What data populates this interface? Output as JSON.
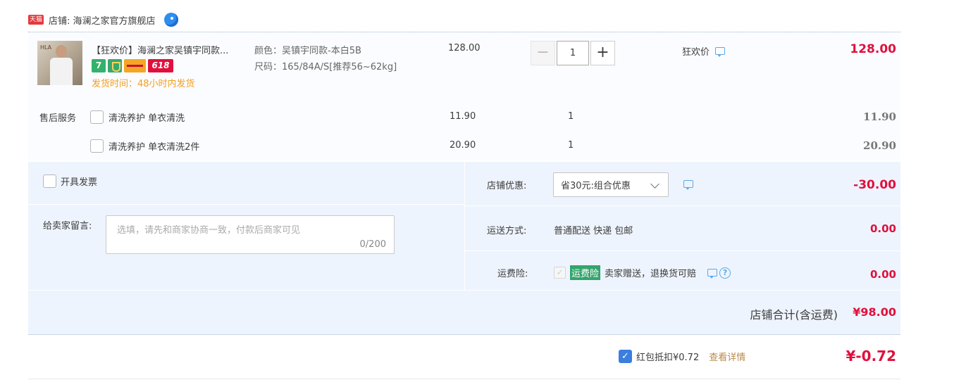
{
  "shop": {
    "badge": "天猫",
    "name": "店铺: 海澜之家官方旗舰店"
  },
  "item": {
    "thumb_caption": "HLA",
    "title": "【狂欢价】海澜之家吴镇宇同款...",
    "tags": [
      "7",
      "618"
    ],
    "ship_time": "发货时间：48小时内发货",
    "sku_color": "颜色：吴镇宇同款-本白5B",
    "sku_size": "尺码：165/84A/S[推荐56~62kg]",
    "price": "128.00",
    "qty": "1",
    "qty_minus": "−",
    "qty_plus": "+",
    "promo_label": "狂欢价",
    "total": "128.00"
  },
  "services": {
    "label": "售后服务",
    "rows": [
      {
        "name": "清洗养护 单衣清洗",
        "price": "11.90",
        "qty": "1",
        "total": "11.90"
      },
      {
        "name": "清洗养护 单衣清洗2件",
        "price": "20.90",
        "qty": "1",
        "total": "20.90"
      }
    ]
  },
  "invoice": {
    "label": "开具发票"
  },
  "message": {
    "label": "给卖家留言:",
    "placeholder": "选填，请先和商家协商一致，付款后商家可见",
    "count": "0/200"
  },
  "coupon": {
    "label": "店铺优惠:",
    "selected": "省30元:组合优惠",
    "value": "-30.00"
  },
  "delivery": {
    "label": "运送方式:",
    "method": "普通配送 快递 包邮",
    "value": "0.00"
  },
  "insurance": {
    "label": "运费险:",
    "badge": "运费险",
    "desc": "卖家赠送，退换货可赔",
    "value": "0.00",
    "help": "?"
  },
  "shop_total": {
    "label": "店铺合计(含运费)",
    "value": "¥98.00"
  },
  "red_packet": {
    "label": "红包抵扣¥0.72",
    "detail": "查看详情",
    "value": "¥-0.72"
  },
  "colors": {
    "accent_red": "#e0103d",
    "panel_blue": "#eef4fd",
    "insurance_green": "#33a56b",
    "checkbox_blue": "#3b7ee0"
  }
}
